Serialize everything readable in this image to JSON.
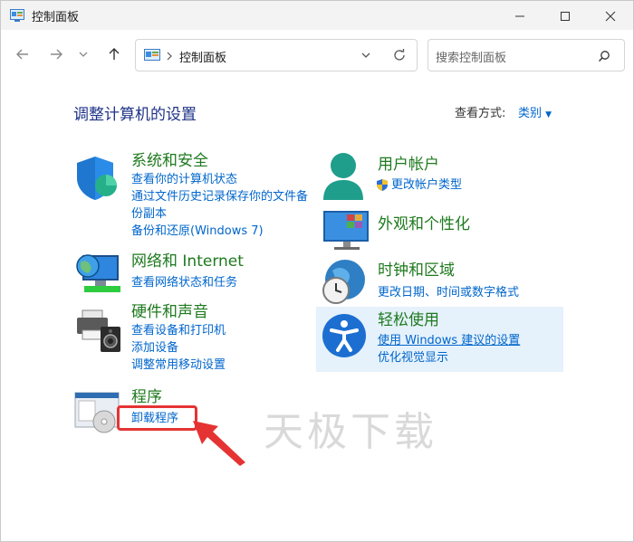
{
  "window": {
    "title": "控制面板"
  },
  "address": {
    "path": "控制面板"
  },
  "search": {
    "placeholder": "搜索控制面板"
  },
  "heading": "调整计算机的设置",
  "view": {
    "label": "查看方式:",
    "value": "类别"
  },
  "left_categories": [
    {
      "title": "系统和安全",
      "links": [
        "查看你的计算机状态",
        "通过文件历史记录保存你的文件备",
        "份副本",
        "备份和还原(Windows 7)"
      ]
    },
    {
      "title": "网络和 Internet",
      "links": [
        "查看网络状态和任务"
      ]
    },
    {
      "title": "硬件和声音",
      "links": [
        "查看设备和打印机",
        "添加设备",
        "调整常用移动设置"
      ]
    },
    {
      "title": "程序",
      "links": [
        "卸载程序"
      ]
    }
  ],
  "right_categories": [
    {
      "title": "用户帐户",
      "links": [
        "更改帐户类型"
      ]
    },
    {
      "title": "外观和个性化",
      "links": []
    },
    {
      "title": "时钟和区域",
      "links": [
        "更改日期、时间或数字格式"
      ]
    },
    {
      "title": "轻松使用",
      "links": [
        "使用 Windows 建议的设置",
        "优化视觉显示"
      ]
    }
  ],
  "watermark": "天极下载",
  "colors": {
    "link": "#0066cc",
    "category_title": "#1e7a1e",
    "heading": "#1e3287",
    "annotation": "#e53333",
    "hover_bg": "#e5f1fb"
  }
}
